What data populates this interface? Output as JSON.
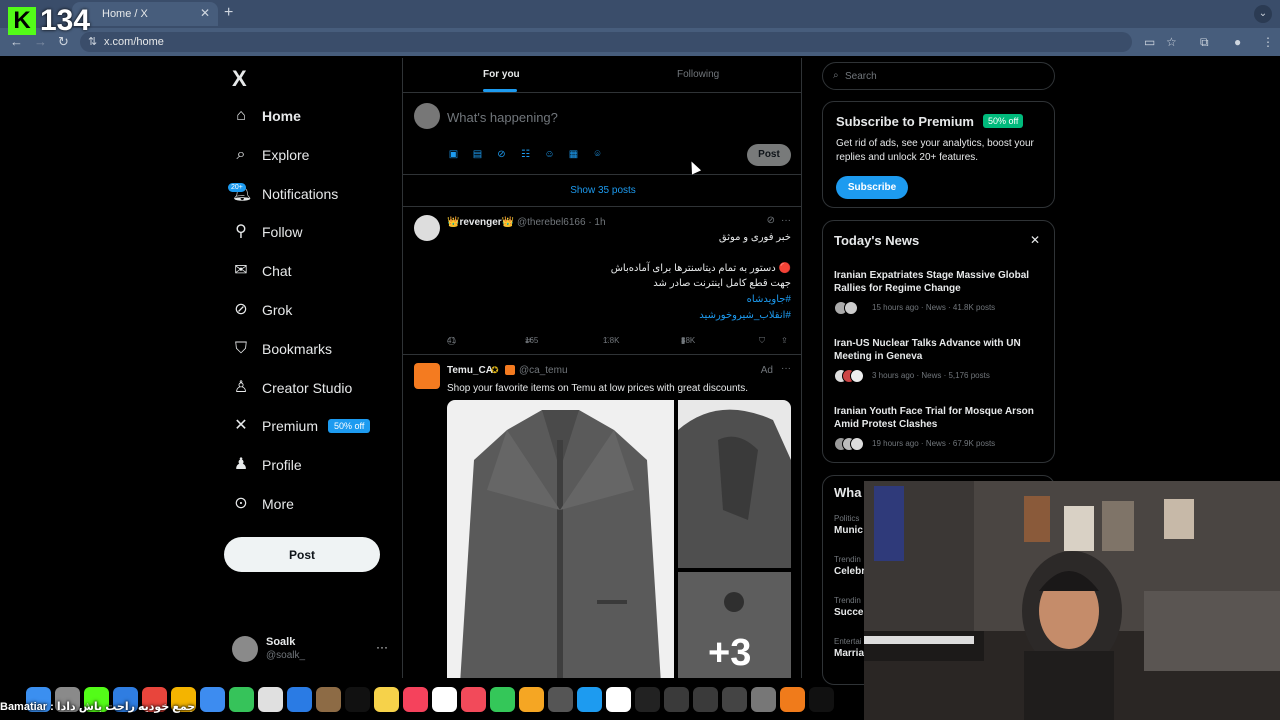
{
  "browser": {
    "tab_title": "Home / X",
    "url": "x.com/home",
    "overlay_counter": "134"
  },
  "nav": {
    "logo": "X",
    "items": [
      {
        "label": "Home",
        "icon": "home-icon"
      },
      {
        "label": "Explore",
        "icon": "search-icon"
      },
      {
        "label": "Notifications",
        "icon": "bell-icon",
        "badge": "20+"
      },
      {
        "label": "Follow",
        "icon": "person-plus-icon"
      },
      {
        "label": "Chat",
        "icon": "mail-icon"
      },
      {
        "label": "Grok",
        "icon": "grok-icon"
      },
      {
        "label": "Bookmarks",
        "icon": "bookmark-icon"
      },
      {
        "label": "Creator Studio",
        "icon": "creator-icon"
      },
      {
        "label": "Premium",
        "icon": "x-icon",
        "pill": "50% off"
      },
      {
        "label": "Profile",
        "icon": "person-icon"
      },
      {
        "label": "More",
        "icon": "more-circle-icon"
      }
    ],
    "post_button": "Post",
    "account": {
      "name": "Soalk",
      "handle": "@soalk_"
    }
  },
  "main": {
    "tabs": [
      "For you",
      "Following"
    ],
    "composer": {
      "placeholder": "What's happening?",
      "post": "Post"
    },
    "show_posts": "Show 35 posts",
    "tweet1": {
      "name": "👑revenger👑",
      "handle": "@therebel6166 · 1h",
      "lines": [
        "خبر فوری و موثق",
        "🔴 دستور به تمام دیتاسنترها برای آماده‌باش",
        "جهت قطع کامل اینترنت صادر شد"
      ],
      "tags": [
        "#جاویدشاه",
        "#انقلاب_شیروخورشید"
      ],
      "replies": "41",
      "reposts": "165",
      "likes": "1.8K",
      "views": "38K"
    },
    "ad": {
      "name": "Temu_CA",
      "handle": "@ca_temu",
      "label": "Ad",
      "body": "Shop your favorite items on Temu at low prices with great discounts.",
      "more_count": "+3"
    }
  },
  "right": {
    "search_placeholder": "Search",
    "premium": {
      "title": "Subscribe to Premium",
      "pill": "50% off",
      "desc": "Get rid of ads, see your analytics, boost your replies and unlock 20+ features.",
      "button": "Subscribe"
    },
    "news": {
      "title": "Today's News",
      "items": [
        {
          "title": "Iranian Expatriates Stage Massive Global Rallies for Regime Change",
          "meta": "15 hours ago · News · 41.8K posts"
        },
        {
          "title": "Iran-US Nuclear Talks Advance with UN Meeting in Geneva",
          "meta": "3 hours ago · News · 5,176 posts"
        },
        {
          "title": "Iranian Youth Face Trial for Mosque Arson Amid Protest Clashes",
          "meta": "19 hours ago · News · 67.9K posts"
        }
      ]
    },
    "whats": {
      "title": "Wha",
      "trends": [
        {
          "cat": "Politics",
          "name": "Munic"
        },
        {
          "cat": "Trendin",
          "name": "Celebr"
        },
        {
          "cat": "Trendin",
          "name": "Succes"
        },
        {
          "cat": "Entertai",
          "name": "Marria"
        }
      ]
    }
  },
  "overlay": {
    "chat_text": "Bamatiar : جمع خودیه راحت باش دادا"
  },
  "colors": {
    "accent": "#1d9bf0",
    "bg": "#000000",
    "border": "#2f3336",
    "muted": "#71767b",
    "green": "#00ba7c"
  }
}
